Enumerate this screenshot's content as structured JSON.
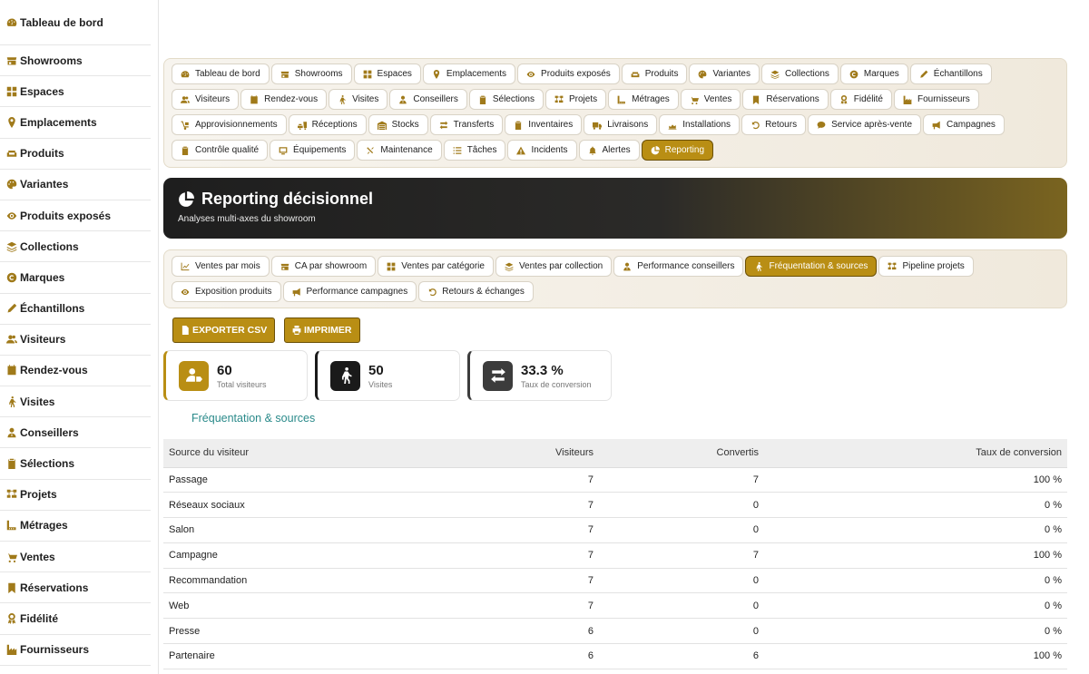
{
  "sidebar": {
    "items": [
      {
        "label": "Tableau de bord",
        "icon": "dashboard-icon"
      },
      {
        "label": "Showrooms",
        "icon": "store-icon"
      },
      {
        "label": "Espaces",
        "icon": "grid-icon"
      },
      {
        "label": "Emplacements",
        "icon": "map-pin-icon"
      },
      {
        "label": "Produits",
        "icon": "couch-icon"
      },
      {
        "label": "Variantes",
        "icon": "palette-icon"
      },
      {
        "label": "Produits exposés",
        "icon": "eye-icon"
      },
      {
        "label": "Collections",
        "icon": "layers-icon"
      },
      {
        "label": "Marques",
        "icon": "copyright-icon"
      },
      {
        "label": "Échantillons",
        "icon": "swatch-icon"
      },
      {
        "label": "Visiteurs",
        "icon": "users-icon"
      },
      {
        "label": "Rendez-vous",
        "icon": "calendar-icon"
      },
      {
        "label": "Visites",
        "icon": "walking-icon"
      },
      {
        "label": "Conseillers",
        "icon": "user-tie-icon"
      },
      {
        "label": "Sélections",
        "icon": "clipboard-icon"
      },
      {
        "label": "Projets",
        "icon": "project-icon"
      },
      {
        "label": "Métrages",
        "icon": "ruler-icon"
      },
      {
        "label": "Ventes",
        "icon": "cart-icon"
      },
      {
        "label": "Réservations",
        "icon": "bookmark-icon"
      },
      {
        "label": "Fidélité",
        "icon": "award-icon"
      },
      {
        "label": "Fournisseurs",
        "icon": "industry-icon"
      }
    ]
  },
  "nav": {
    "items": [
      {
        "label": "Tableau de bord",
        "icon": "dashboard-icon",
        "active": false
      },
      {
        "label": "Showrooms",
        "icon": "store-icon",
        "active": false
      },
      {
        "label": "Espaces",
        "icon": "grid-icon",
        "active": false
      },
      {
        "label": "Emplacements",
        "icon": "map-pin-icon",
        "active": false
      },
      {
        "label": "Produits exposés",
        "icon": "eye-icon",
        "active": false
      },
      {
        "label": "Produits",
        "icon": "couch-icon",
        "active": false
      },
      {
        "label": "Variantes",
        "icon": "palette-icon",
        "active": false
      },
      {
        "label": "Collections",
        "icon": "layers-icon",
        "active": false
      },
      {
        "label": "Marques",
        "icon": "copyright-icon",
        "active": false
      },
      {
        "label": "Échantillons",
        "icon": "swatch-icon",
        "active": false
      },
      {
        "label": "Visiteurs",
        "icon": "users-icon",
        "active": false
      },
      {
        "label": "Rendez-vous",
        "icon": "calendar-icon",
        "active": false
      },
      {
        "label": "Visites",
        "icon": "walking-icon",
        "active": false
      },
      {
        "label": "Conseillers",
        "icon": "user-tie-icon",
        "active": false
      },
      {
        "label": "Sélections",
        "icon": "clipboard-icon",
        "active": false
      },
      {
        "label": "Projets",
        "icon": "project-icon",
        "active": false
      },
      {
        "label": "Métrages",
        "icon": "ruler-icon",
        "active": false
      },
      {
        "label": "Ventes",
        "icon": "cart-icon",
        "active": false
      },
      {
        "label": "Réservations",
        "icon": "bookmark-icon",
        "active": false
      },
      {
        "label": "Fidélité",
        "icon": "award-icon",
        "active": false
      },
      {
        "label": "Fournisseurs",
        "icon": "industry-icon",
        "active": false
      },
      {
        "label": "Approvisionnements",
        "icon": "dolly-icon",
        "active": false
      },
      {
        "label": "Réceptions",
        "icon": "truck-loading-icon",
        "active": false
      },
      {
        "label": "Stocks",
        "icon": "warehouse-icon",
        "active": false
      },
      {
        "label": "Transferts",
        "icon": "exchange-icon",
        "active": false
      },
      {
        "label": "Inventaires",
        "icon": "clipboard-check-icon",
        "active": false
      },
      {
        "label": "Livraisons",
        "icon": "truck-icon",
        "active": false
      },
      {
        "label": "Installations",
        "icon": "tools-icon",
        "active": false
      },
      {
        "label": "Retours",
        "icon": "undo-icon",
        "active": false
      },
      {
        "label": "Service après-vente",
        "icon": "comment-icon",
        "active": false
      },
      {
        "label": "Campagnes",
        "icon": "bullhorn-icon",
        "active": false
      },
      {
        "label": "Contrôle qualité",
        "icon": "clipboard-check-icon",
        "active": false
      },
      {
        "label": "Équipements",
        "icon": "monitor-icon",
        "active": false
      },
      {
        "label": "Maintenance",
        "icon": "wrench-icon",
        "active": false
      },
      {
        "label": "Tâches",
        "icon": "list-icon",
        "active": false
      },
      {
        "label": "Incidents",
        "icon": "warning-icon",
        "active": false
      },
      {
        "label": "Alertes",
        "icon": "bell-icon",
        "active": false
      },
      {
        "label": "Reporting",
        "icon": "pie-chart-icon",
        "active": true
      }
    ]
  },
  "banner": {
    "title": "Reporting décisionnel",
    "subtitle": "Analyses multi-axes du showroom"
  },
  "reports": {
    "items": [
      {
        "label": "Ventes par mois",
        "icon": "line-chart-icon",
        "active": false
      },
      {
        "label": "CA par showroom",
        "icon": "store-icon",
        "active": false
      },
      {
        "label": "Ventes par catégorie",
        "icon": "grid-icon",
        "active": false
      },
      {
        "label": "Ventes par collection",
        "icon": "layers-icon",
        "active": false
      },
      {
        "label": "Performance conseillers",
        "icon": "user-tie-icon",
        "active": false
      },
      {
        "label": "Fréquentation & sources",
        "icon": "walking-icon",
        "active": true
      },
      {
        "label": "Pipeline projets",
        "icon": "project-icon",
        "active": false
      },
      {
        "label": "Exposition produits",
        "icon": "eye-icon",
        "active": false
      },
      {
        "label": "Performance campagnes",
        "icon": "bullhorn-icon",
        "active": false
      },
      {
        "label": "Retours & échanges",
        "icon": "undo-icon",
        "active": false
      }
    ]
  },
  "actions": {
    "export_label": "EXPORTER CSV",
    "print_label": "IMPRIMER"
  },
  "kpis": [
    {
      "value": "60",
      "label": "Total visiteurs",
      "icon": "user-tag-icon",
      "color": "#b98e14"
    },
    {
      "value": "50",
      "label": "Visites",
      "icon": "walking-icon",
      "color": "#1a1a1a"
    },
    {
      "value": "33.3 %",
      "label": "Taux de conversion",
      "icon": "exchange-icon",
      "color": "#3c3c3c"
    }
  ],
  "section_title": "Fréquentation & sources",
  "table": {
    "columns": [
      "Source du visiteur",
      "Visiteurs",
      "Convertis",
      "Taux de conversion"
    ],
    "rows": [
      [
        "Passage",
        "7",
        "7",
        "100 %"
      ],
      [
        "Réseaux sociaux",
        "7",
        "0",
        "0 %"
      ],
      [
        "Salon",
        "7",
        "0",
        "0 %"
      ],
      [
        "Campagne",
        "7",
        "7",
        "100 %"
      ],
      [
        "Recommandation",
        "7",
        "0",
        "0 %"
      ],
      [
        "Web",
        "7",
        "0",
        "0 %"
      ],
      [
        "Presse",
        "6",
        "0",
        "0 %"
      ],
      [
        "Partenaire",
        "6",
        "6",
        "100 %"
      ]
    ]
  },
  "colors": {
    "accent": "#b98e14",
    "accent_dark": "#6b5007",
    "section_title": "#2a8a8a"
  }
}
